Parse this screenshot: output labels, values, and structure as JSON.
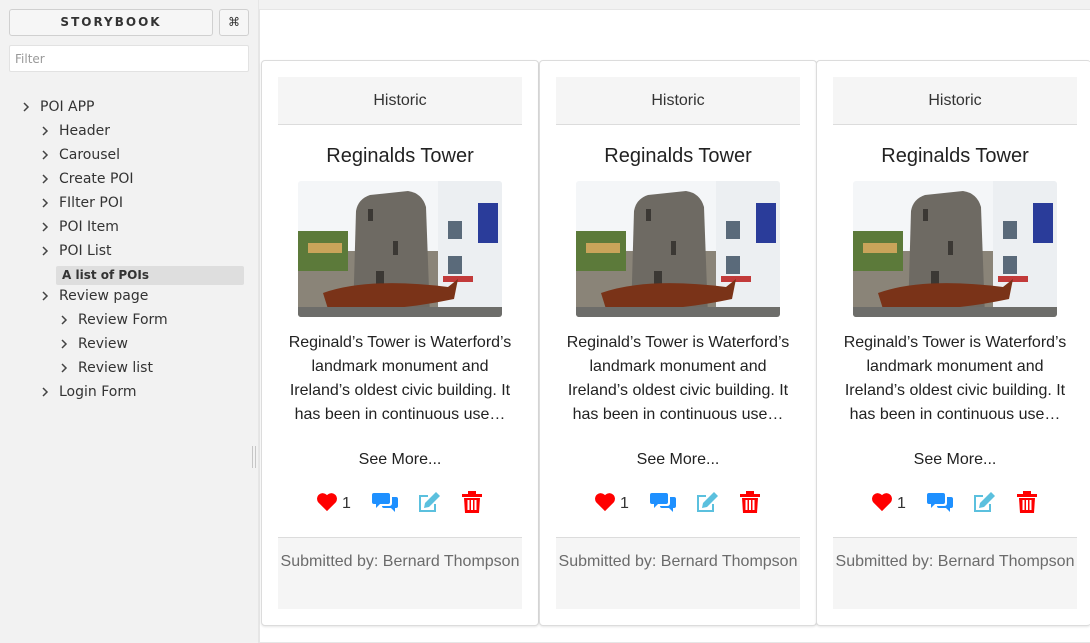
{
  "sidebar": {
    "brand": "STORYBOOK",
    "shortcut": "⌘",
    "filter_placeholder": "Filter",
    "tree": [
      {
        "label": "POI APP",
        "level": 0
      },
      {
        "label": "Header",
        "level": 1
      },
      {
        "label": "Carousel",
        "level": 1
      },
      {
        "label": "Create POI",
        "level": 1
      },
      {
        "label": "FIlter POI",
        "level": 1
      },
      {
        "label": "POI Item",
        "level": 1
      },
      {
        "label": "POI List",
        "level": 1
      },
      {
        "label": "Review page",
        "level": 1
      },
      {
        "label": "Review Form",
        "level": 2
      },
      {
        "label": "Review",
        "level": 2
      },
      {
        "label": "Review list",
        "level": 2
      },
      {
        "label": "Login Form",
        "level": 1
      }
    ],
    "active_story": "A list of POIs"
  },
  "cards": [
    {
      "category": "Historic",
      "title": "Reginalds Tower",
      "description": "Reginald’s Tower is Waterford’s landmark monument and Ireland’s oldest civic building. It has been in continuous use…",
      "see_more": "See More...",
      "likes": "1",
      "submitted_by": "Submitted by: Bernard Thompson"
    },
    {
      "category": "Historic",
      "title": "Reginalds Tower",
      "description": "Reginald’s Tower is Waterford’s landmark monument and Ireland’s oldest civic building. It has been in continuous use…",
      "see_more": "See More...",
      "likes": "1",
      "submitted_by": "Submitted by: Bernard Thompson"
    },
    {
      "category": "Historic",
      "title": "Reginalds Tower",
      "description": "Reginald’s Tower is Waterford’s landmark monument and Ireland’s oldest civic building. It has been in continuous use…",
      "see_more": "See More...",
      "likes": "1",
      "submitted_by": "Submitted by: Bernard Thompson"
    }
  ],
  "icons": {
    "like": "heart-icon",
    "comments": "comments-icon",
    "edit": "edit-icon",
    "delete": "trash-icon"
  },
  "colors": {
    "like": "#ff0000",
    "comments": "#1e90ff",
    "edit": "#5bc0de",
    "delete": "#ff0000"
  }
}
